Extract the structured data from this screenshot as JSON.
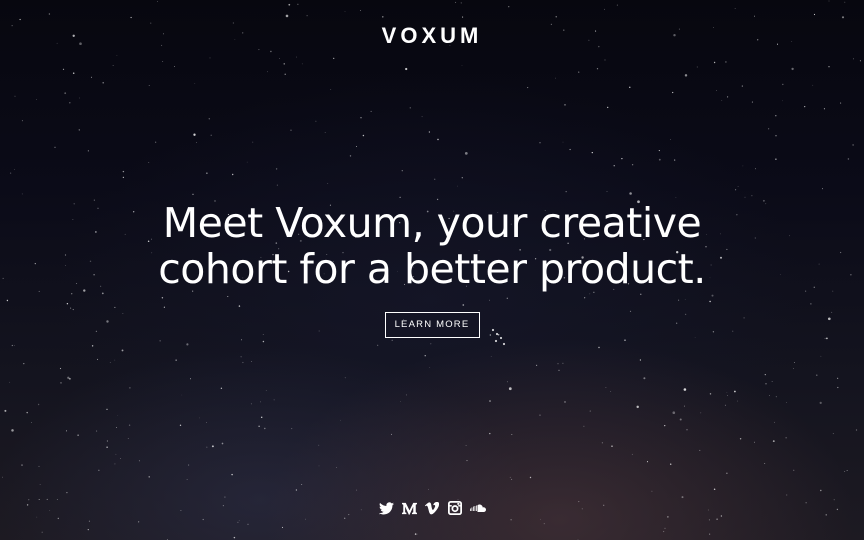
{
  "brand": {
    "name": "VOXUM"
  },
  "hero": {
    "headline_line1": "Meet Voxum, your creative",
    "headline_line2": "cohort for a better product.",
    "cta_label": "LEARN MORE"
  },
  "social": {
    "icons": [
      "twitter-icon",
      "medium-icon",
      "vimeo-icon",
      "instagram-icon",
      "soundcloud-icon"
    ]
  },
  "colors": {
    "text": "#ffffff",
    "background": "#0b0b18"
  }
}
